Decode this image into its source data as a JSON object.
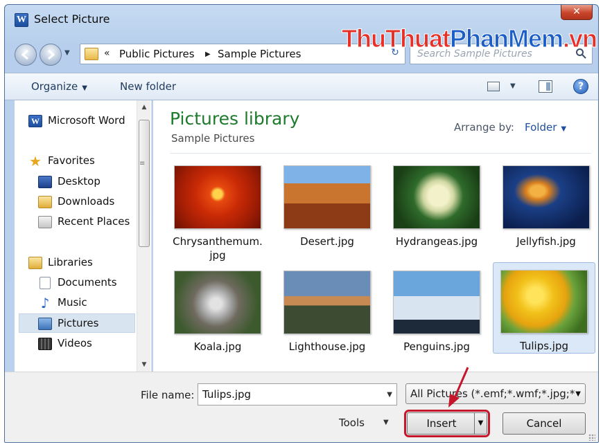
{
  "window": {
    "app_icon": "W",
    "title": "Select Picture",
    "close_label": "✕"
  },
  "watermark": {
    "part1": "ThuThuat",
    "part2": "PhanMem",
    "part3": ".vn"
  },
  "address_bar": {
    "overflow": "«",
    "crumbs": [
      "Public Pictures",
      "Sample Pictures"
    ],
    "separator": "▶"
  },
  "search": {
    "placeholder": "Search Sample Pictures"
  },
  "toolbar": {
    "organize_label": "Organize",
    "new_folder_label": "New folder"
  },
  "sidebar": {
    "items": [
      {
        "label": "Microsoft Word",
        "icon": "word-icon"
      },
      {
        "label": "Favorites",
        "icon": "star-icon"
      },
      {
        "label": "Desktop",
        "icon": "desktop-icon"
      },
      {
        "label": "Downloads",
        "icon": "downloads-folder-icon"
      },
      {
        "label": "Recent Places",
        "icon": "recent-places-icon"
      },
      {
        "label": "Libraries",
        "icon": "libraries-icon"
      },
      {
        "label": "Documents",
        "icon": "document-icon"
      },
      {
        "label": "Music",
        "icon": "music-note-icon"
      },
      {
        "label": "Pictures",
        "icon": "pictures-icon",
        "selected": true
      },
      {
        "label": "Videos",
        "icon": "film-icon"
      }
    ]
  },
  "main": {
    "library_title": "Pictures library",
    "library_subtitle": "Sample Pictures",
    "arrange_label": "Arrange by:",
    "arrange_value": "Folder",
    "files": [
      {
        "line1": "Chrysanthemum.",
        "line2": "jpg"
      },
      {
        "line1": "Desert.jpg",
        "line2": ""
      },
      {
        "line1": "Hydrangeas.jpg",
        "line2": ""
      },
      {
        "line1": "Jellyfish.jpg",
        "line2": ""
      },
      {
        "line1": "Koala.jpg",
        "line2": ""
      },
      {
        "line1": "Lighthouse.jpg",
        "line2": ""
      },
      {
        "line1": "Penguins.jpg",
        "line2": ""
      },
      {
        "line1": "Tulips.jpg",
        "line2": "",
        "selected": true
      }
    ]
  },
  "footer": {
    "file_name_label": "File name:",
    "file_name_value": "Tulips.jpg",
    "file_type_value": "All Pictures (*.emf;*.wmf;*.jpg;*",
    "tools_label": "Tools",
    "insert_label": "Insert",
    "cancel_label": "Cancel"
  },
  "colors": {
    "highlight_box": "#c4172c",
    "library_title": "#1e7a2c",
    "link_blue": "#1e4f9e"
  }
}
